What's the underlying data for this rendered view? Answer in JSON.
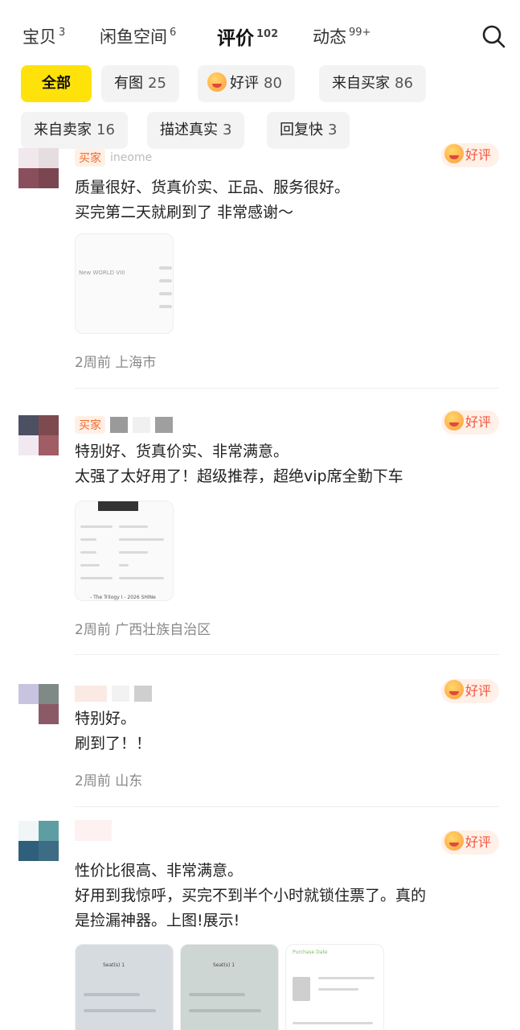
{
  "tabs": [
    {
      "label": "宝贝",
      "count": "3"
    },
    {
      "label": "闲鱼空间",
      "count": "6"
    },
    {
      "label": "评价",
      "count": "102"
    },
    {
      "label": "动态",
      "count": "99+"
    }
  ],
  "filters": [
    {
      "label": "全部",
      "count": ""
    },
    {
      "label": "有图",
      "count": "25"
    },
    {
      "label": "好评",
      "count": "80"
    },
    {
      "label": "来自买家",
      "count": "86"
    },
    {
      "label": "来自卖家",
      "count": "16"
    },
    {
      "label": "描述真实",
      "count": "3"
    },
    {
      "label": "回复快",
      "count": "3"
    }
  ],
  "reviews": [
    {
      "role": "买家",
      "username": "ineome",
      "badge": "好评",
      "text": [
        "质量很好、货真价实、正品、服务很好。",
        "买完第二天就刷到了 非常感谢～"
      ],
      "meta": "2周前 上海市",
      "images": [
        "New WORLD VIII"
      ]
    },
    {
      "role": "买家",
      "username": "",
      "badge": "好评",
      "text": [
        "特别好、货真价实、非常满意。",
        "太强了太好用了！超级推荐，超绝vip席全勤下车"
      ],
      "meta": "2周前 广西壮族自治区",
      "images": [
        "- The Trilogy I - 2026 SHINe"
      ]
    },
    {
      "role": "",
      "username": "",
      "badge": "好评",
      "text": [
        "特别好。",
        "刷到了！！"
      ],
      "meta": "2周前 山东",
      "images": []
    },
    {
      "role": "",
      "username": "",
      "badge": "好评",
      "text": [
        "性价比很高、非常满意。",
        "好用到我惊呼，买完不到半个小时就锁住票了。真的",
        "是捡漏神器。上图!展示!"
      ],
      "meta": "",
      "images": [
        "Seat(s) 1",
        "Seat(s) 1",
        "Purchase Date"
      ]
    }
  ],
  "colors": {
    "accent": "#ffe20a",
    "badge_text": "#f4553b",
    "badge_bg": "#fff0e8"
  }
}
